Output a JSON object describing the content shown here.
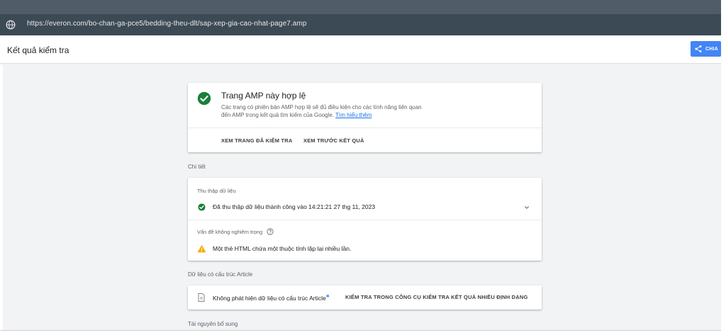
{
  "browser": {
    "url": "https://everon.com/bo-chan-ga-pce5/bedding-theu-dlt/sap-xep-gia-cao-nhat-page7.amp"
  },
  "header": {
    "title": "Kết quả kiểm tra",
    "share_label": "CHIA"
  },
  "amp_status": {
    "title": "Trang AMP này hợp lệ",
    "description_line1": "Các trang có phiên bản AMP hợp lệ sẽ đủ điều kiện cho các tính năng liên quan",
    "description_line2": "đến AMP trong kết quả tìm kiếm của Google.",
    "learn_more": "Tìm hiểu thêm",
    "view_tested": "XEM TRANG ĐÃ KIỂM TRA",
    "preview_result": "XEM TRƯỚC KẾT QUẢ"
  },
  "details": {
    "section_label": "Chi tiết",
    "crawl_label": "Thu thập dữ liệu",
    "crawl_status": "Đã thu thập dữ liệu thành công vào 14:21:21 27 thg 11, 2023",
    "issues_label": "Vấn đề không nghiêm trọng",
    "issue_text": "Một thẻ HTML chứa một thuộc tính lặp lại nhiều lần."
  },
  "article": {
    "section_label": "Dữ liệu có cấu trúc Article",
    "status": "Không phát hiện dữ liệu có cấu trúc Article",
    "cta": "KIỂM TRA TRONG CÔNG CỤ KIỂM TRA KẾT QUẢ NHIỀU ĐỊNH DẠNG"
  },
  "additional": {
    "section_label": "Tài nguyên bổ sung"
  },
  "colors": {
    "success": "#188038",
    "warning": "#f9ab00",
    "accent": "#4285f4",
    "link": "#1a73e8"
  }
}
